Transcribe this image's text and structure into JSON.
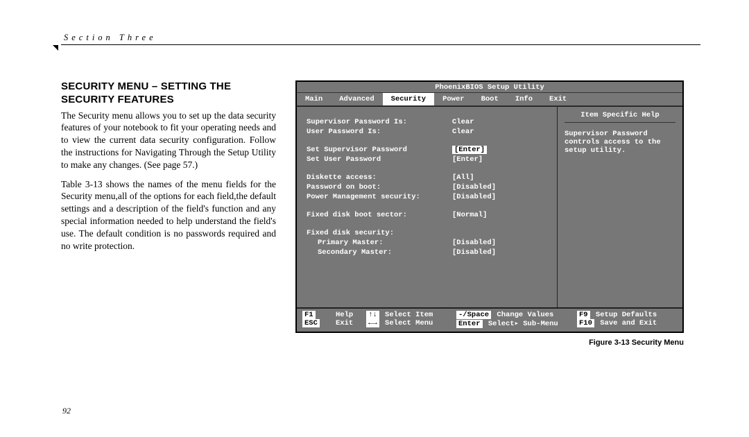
{
  "header": {
    "section_label": "Section Three"
  },
  "left_column": {
    "heading": "SECURITY MENU – SETTING THE SECURITY FEATURES",
    "para1": "The Security menu allows you to set up the data security features of your notebook to fit your operating needs and to view the current data security configuration. Follow the instructions for Navigating Through the Setup Utility to make any changes. (See page 57.)",
    "para2": "Table 3-13 shows the names of the menu fields for the Security menu,all  of the options for each field,the  default settings and a description of the field's function and any special information needed to help understand the field's use. The default condition is no passwords required and no write protection."
  },
  "bios": {
    "title": "PhoenixBIOS Setup Utility",
    "tabs": [
      "Main",
      "Advanced",
      "Security",
      "Power",
      "Boot",
      "Info",
      "Exit"
    ],
    "active_tab_index": 2,
    "help_header": "Item Specific Help",
    "help_lines": [
      "Supervisor Password",
      "controls access to the",
      "setup utility."
    ],
    "rows": [
      {
        "label": "Supervisor Password Is:",
        "value": "Clear"
      },
      {
        "label": "User Password Is:",
        "value": "Clear"
      },
      {
        "spacer": true
      },
      {
        "label": "Set Supervisor Password",
        "value": "[Enter]",
        "highlight": true
      },
      {
        "label": "Set User Password",
        "value": "[Enter]"
      },
      {
        "spacer": true
      },
      {
        "label": "Diskette access:",
        "value": "[All]"
      },
      {
        "label": "Password on boot:",
        "value": "[Disabled]"
      },
      {
        "label": "Power Management security:",
        "value": "[Disabled]"
      },
      {
        "spacer": true
      },
      {
        "label": "Fixed disk boot sector:",
        "value": "[Normal]"
      },
      {
        "spacer": true
      },
      {
        "label": "Fixed disk security:",
        "value": ""
      },
      {
        "label": "Primary Master:",
        "value": "[Disabled]",
        "indent": true
      },
      {
        "label": "Secondary Master:",
        "value": "[Disabled]",
        "indent": true
      }
    ],
    "footer": {
      "f1": "F1",
      "f1_text": "Help",
      "nav1": "↑↓",
      "nav1_text": "Select Item",
      "ch": "-/Space",
      "ch_text": "Change Values",
      "f9": "F9",
      "f9_text": "Setup Defaults",
      "esc": "ESC",
      "esc_text": "Exit",
      "nav2": "←→",
      "nav2_text": "Select Menu",
      "ent": "Enter",
      "ent_text": "Select▸ Sub-Menu",
      "f10": "F10",
      "f10_text": "Save and Exit"
    }
  },
  "caption": "Figure 3-13 Security Menu",
  "page_number": "92"
}
